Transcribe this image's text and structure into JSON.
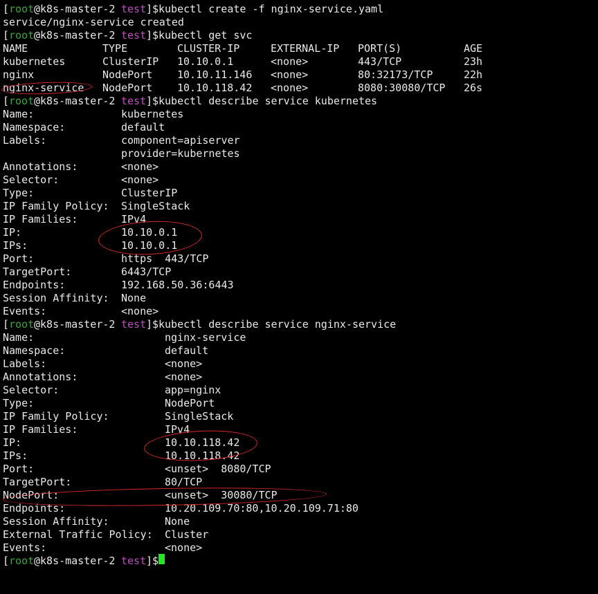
{
  "terminal": {
    "prompt": {
      "open": "[",
      "user": "root",
      "host": "@k8s-master-2 ",
      "dir": "test",
      "close": "]$"
    },
    "cmd1": {
      "text": "kubectl create -f nginx-service.yaml",
      "output": "service/nginx-service created"
    },
    "cmd2": {
      "text": "kubectl get svc",
      "headers": [
        "NAME",
        "TYPE",
        "CLUSTER-IP",
        "EXTERNAL-IP",
        "PORT(S)",
        "AGE"
      ],
      "rows": [
        [
          "kubernetes",
          "ClusterIP",
          "10.10.0.1",
          "<none>",
          "443/TCP",
          "23h"
        ],
        [
          "nginx",
          "NodePort",
          "10.10.11.146",
          "<none>",
          "80:32173/TCP",
          "22h"
        ],
        [
          "nginx-service",
          "NodePort",
          "10.10.118.42",
          "<none>",
          "8080:30080/TCP",
          "26s"
        ]
      ]
    },
    "cmd3": {
      "text": "kubectl describe service kubernetes",
      "fields": [
        [
          "Name:",
          "kubernetes"
        ],
        [
          "Namespace:",
          "default"
        ],
        [
          "Labels:",
          "component=apiserver"
        ],
        [
          "",
          "provider=kubernetes"
        ],
        [
          "Annotations:",
          "<none>"
        ],
        [
          "Selector:",
          "<none>"
        ],
        [
          "Type:",
          "ClusterIP"
        ],
        [
          "IP Family Policy:",
          "SingleStack"
        ],
        [
          "IP Families:",
          "IPv4"
        ],
        [
          "IP:",
          "10.10.0.1"
        ],
        [
          "IPs:",
          "10.10.0.1"
        ],
        [
          "Port:",
          "https  443/TCP"
        ],
        [
          "TargetPort:",
          "6443/TCP"
        ],
        [
          "Endpoints:",
          "192.168.50.36:6443"
        ],
        [
          "Session Affinity:",
          "None"
        ],
        [
          "Events:",
          "<none>"
        ]
      ]
    },
    "cmd4": {
      "text": "kubectl describe service nginx-service",
      "fields": [
        [
          "Name:",
          "nginx-service"
        ],
        [
          "Namespace:",
          "default"
        ],
        [
          "Labels:",
          "<none>"
        ],
        [
          "Annotations:",
          "<none>"
        ],
        [
          "Selector:",
          "app=nginx"
        ],
        [
          "Type:",
          "NodePort"
        ],
        [
          "IP Family Policy:",
          "SingleStack"
        ],
        [
          "IP Families:",
          "IPv4"
        ],
        [
          "IP:",
          "10.10.118.42"
        ],
        [
          "IPs:",
          "10.10.118.42"
        ],
        [
          "Port:",
          "<unset>  8080/TCP"
        ],
        [
          "TargetPort:",
          "80/TCP"
        ],
        [
          "NodePort:",
          "<unset>  30080/TCP"
        ],
        [
          "Endpoints:",
          "10.20.109.70:80,10.20.109.71:80"
        ],
        [
          "Session Affinity:",
          "None"
        ],
        [
          "External Traffic Policy:",
          "Cluster"
        ],
        [
          "Events:",
          "<none>"
        ]
      ]
    }
  },
  "colors": {
    "background": "#000000",
    "text": "#e9e9e9",
    "user": "#3aa53a",
    "dir": "#c04cc0",
    "annotation": "#d82828",
    "cursor": "#22e822"
  }
}
